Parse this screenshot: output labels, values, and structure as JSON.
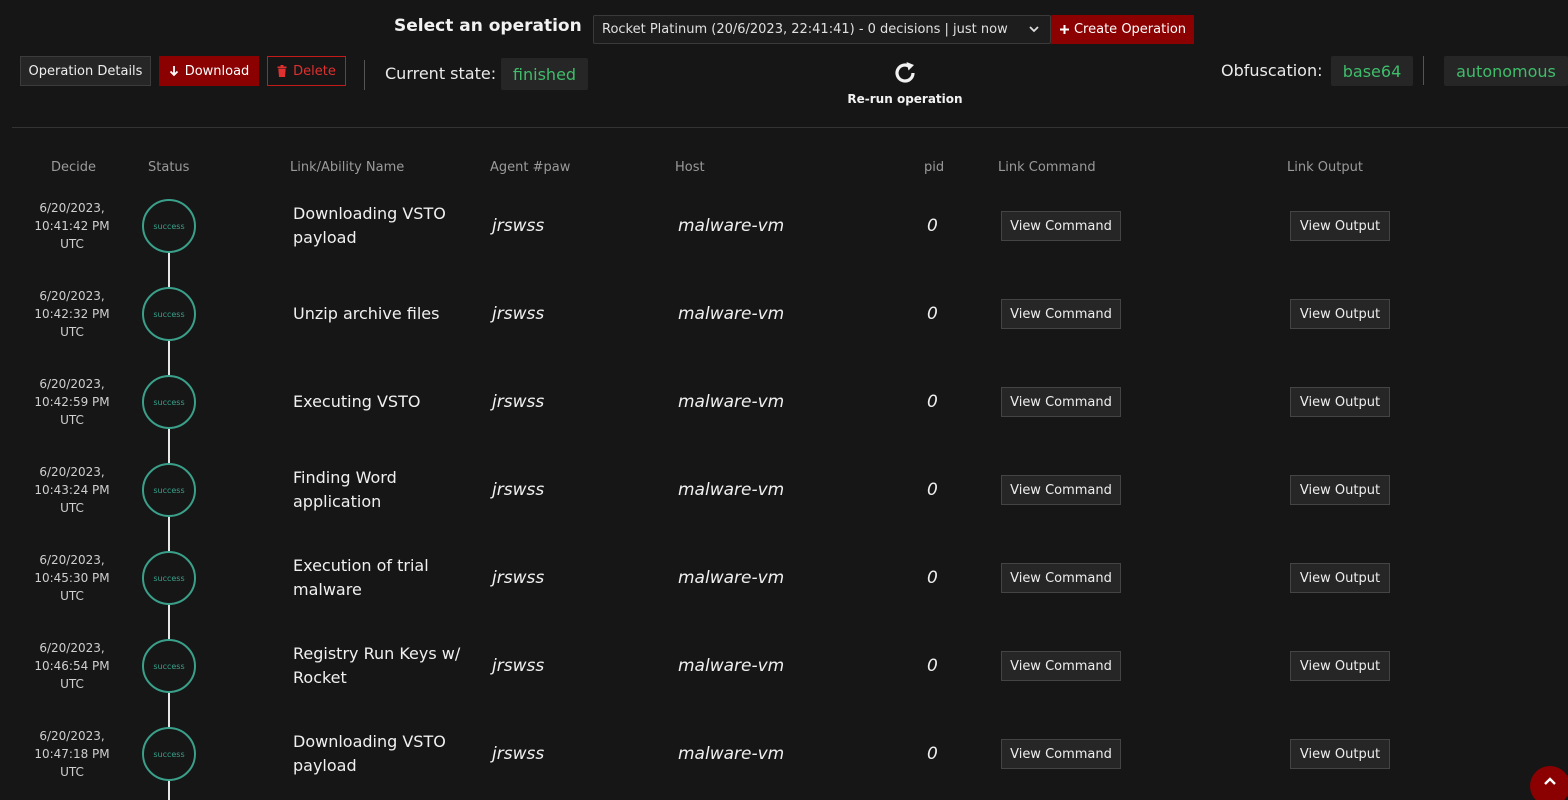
{
  "header": {
    "select_label": "Select an operation",
    "selected_operation": "Rocket Platinum (20/6/2023, 22:41:41) - 0 decisions | just now",
    "create_label": "Create Operation"
  },
  "toolbar": {
    "details_label": "Operation Details",
    "download_label": "Download",
    "delete_label": "Delete",
    "state_label": "Current state:",
    "state_value": "finished",
    "rerun_label": "Re-run operation",
    "obfuscation_label": "Obfuscation:",
    "obfuscation_value": "base64",
    "mode_value": "autonomous"
  },
  "table": {
    "columns": [
      "Decide",
      "Status",
      "Link/Ability Name",
      "Agent #paw",
      "Host",
      "pid",
      "Link Command",
      "Link Output"
    ],
    "command_button": "View Command",
    "output_button": "View Output",
    "rows": [
      {
        "date": "6/20/2023,",
        "time": "10:41:42 PM",
        "tz": "UTC",
        "status": "success",
        "name": "Downloading VSTO payload",
        "paw": "jrswss",
        "host": "malware-vm",
        "pid": "0"
      },
      {
        "date": "6/20/2023,",
        "time": "10:42:32 PM",
        "tz": "UTC",
        "status": "success",
        "name": "Unzip archive files",
        "paw": "jrswss",
        "host": "malware-vm",
        "pid": "0"
      },
      {
        "date": "6/20/2023,",
        "time": "10:42:59 PM",
        "tz": "UTC",
        "status": "success",
        "name": "Executing VSTO",
        "paw": "jrswss",
        "host": "malware-vm",
        "pid": "0"
      },
      {
        "date": "6/20/2023,",
        "time": "10:43:24 PM",
        "tz": "UTC",
        "status": "success",
        "name": "Finding Word application",
        "paw": "jrswss",
        "host": "malware-vm",
        "pid": "0"
      },
      {
        "date": "6/20/2023,",
        "time": "10:45:30 PM",
        "tz": "UTC",
        "status": "success",
        "name": "Execution of trial malware",
        "paw": "jrswss",
        "host": "malware-vm",
        "pid": "0"
      },
      {
        "date": "6/20/2023,",
        "time": "10:46:54 PM",
        "tz": "UTC",
        "status": "success",
        "name": "Registry Run Keys w/ Rocket",
        "paw": "jrswss",
        "host": "malware-vm",
        "pid": "0"
      },
      {
        "date": "6/20/2023,",
        "time": "10:47:18 PM",
        "tz": "UTC",
        "status": "success",
        "name": "Downloading VSTO payload",
        "paw": "jrswss",
        "host": "malware-vm",
        "pid": "0"
      }
    ]
  },
  "colors": {
    "accent_red": "#8b0000",
    "success_teal": "#3aa08a",
    "state_green": "#3fbd6b"
  },
  "icons": [
    "chevron-down-icon",
    "plus-icon",
    "download-arrow-icon",
    "trash-icon",
    "refresh-icon",
    "chevron-up-icon"
  ]
}
